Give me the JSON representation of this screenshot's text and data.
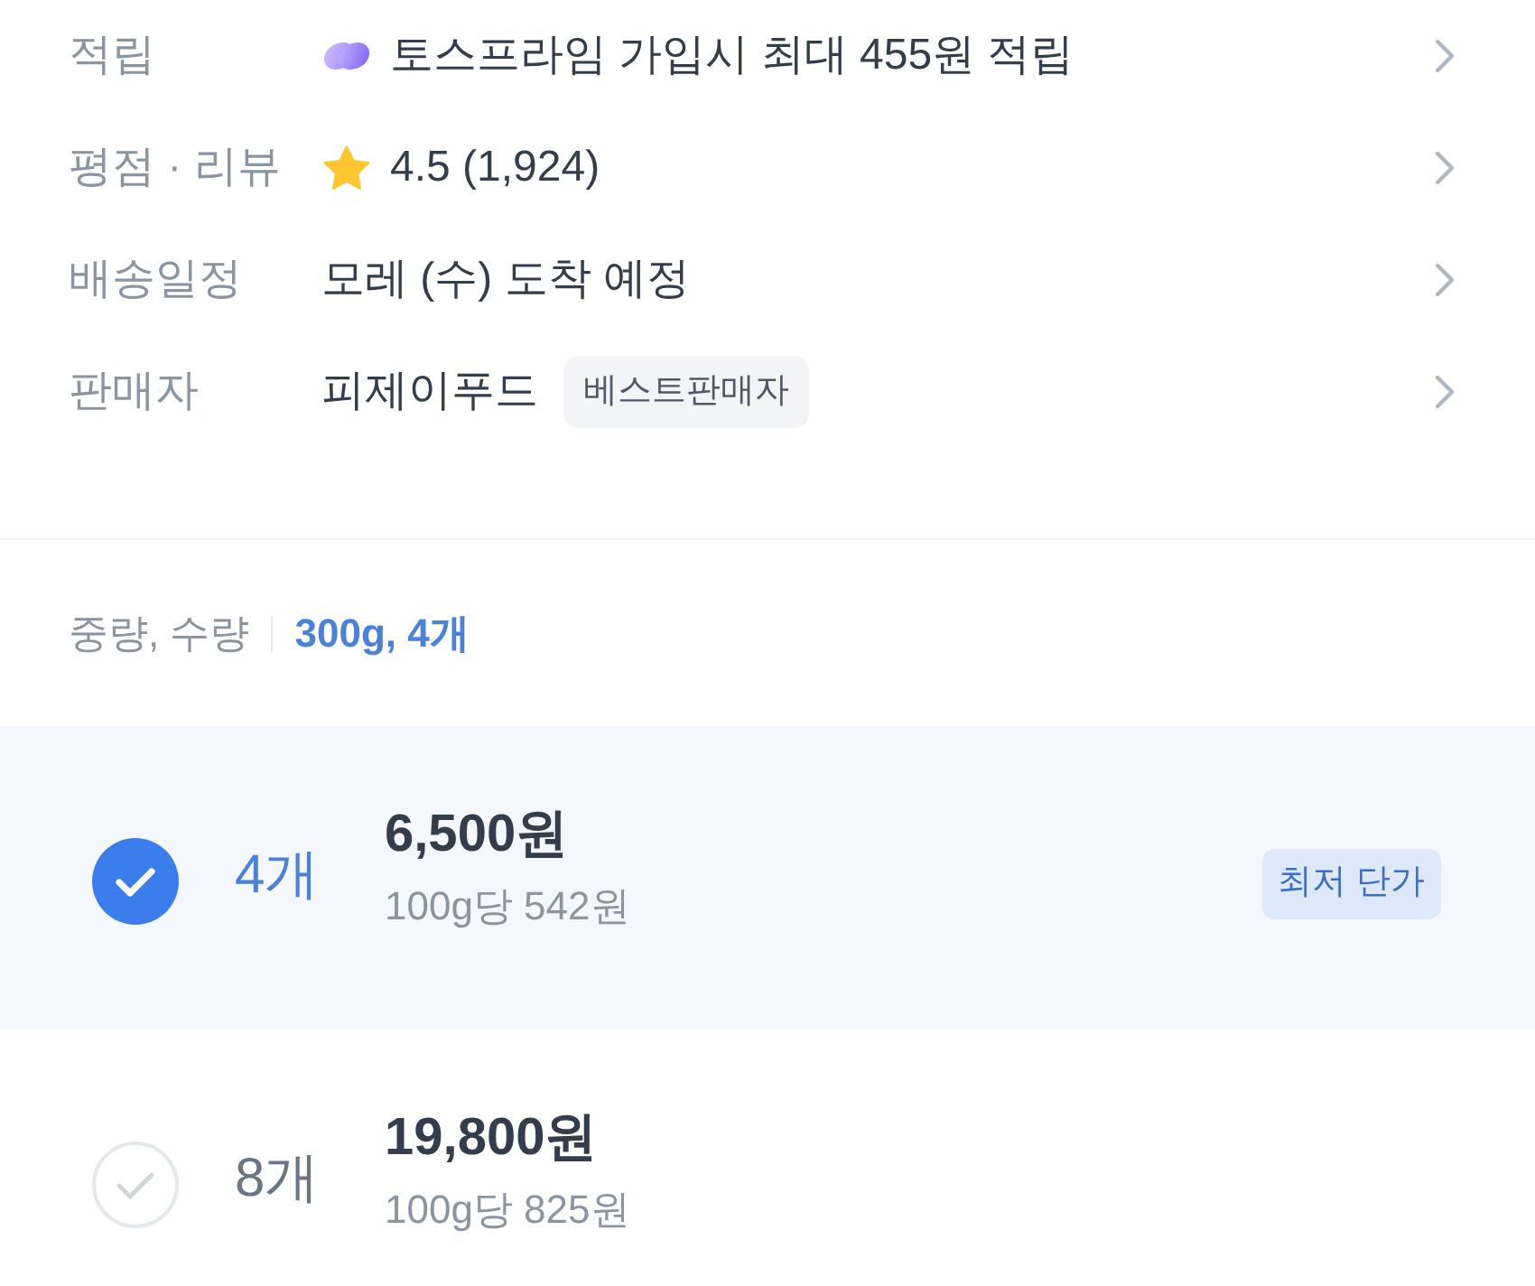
{
  "info_rows": [
    {
      "kind": "reward",
      "label": "적립",
      "value": "토스프라임 가입시 최대 455원 적립"
    },
    {
      "kind": "rating",
      "label": "평점 · 리뷰",
      "value": "4.5 (1,924)"
    },
    {
      "kind": "text",
      "label": "배송일정",
      "value": "모레 (수) 도착 예정"
    },
    {
      "kind": "seller",
      "label": "판매자",
      "value": "피제이푸드",
      "badge": "베스트판매자"
    }
  ],
  "option_header": {
    "label": "중량, 수량",
    "value": "300g, 4개"
  },
  "options": [
    {
      "quantity": "4개",
      "price": "6,500원",
      "unit_price": "100g당 542원",
      "badge": "최저 단가",
      "selected": true
    },
    {
      "quantity": "8개",
      "price": "19,800원",
      "unit_price": "100g당 825원",
      "selected": false
    }
  ]
}
